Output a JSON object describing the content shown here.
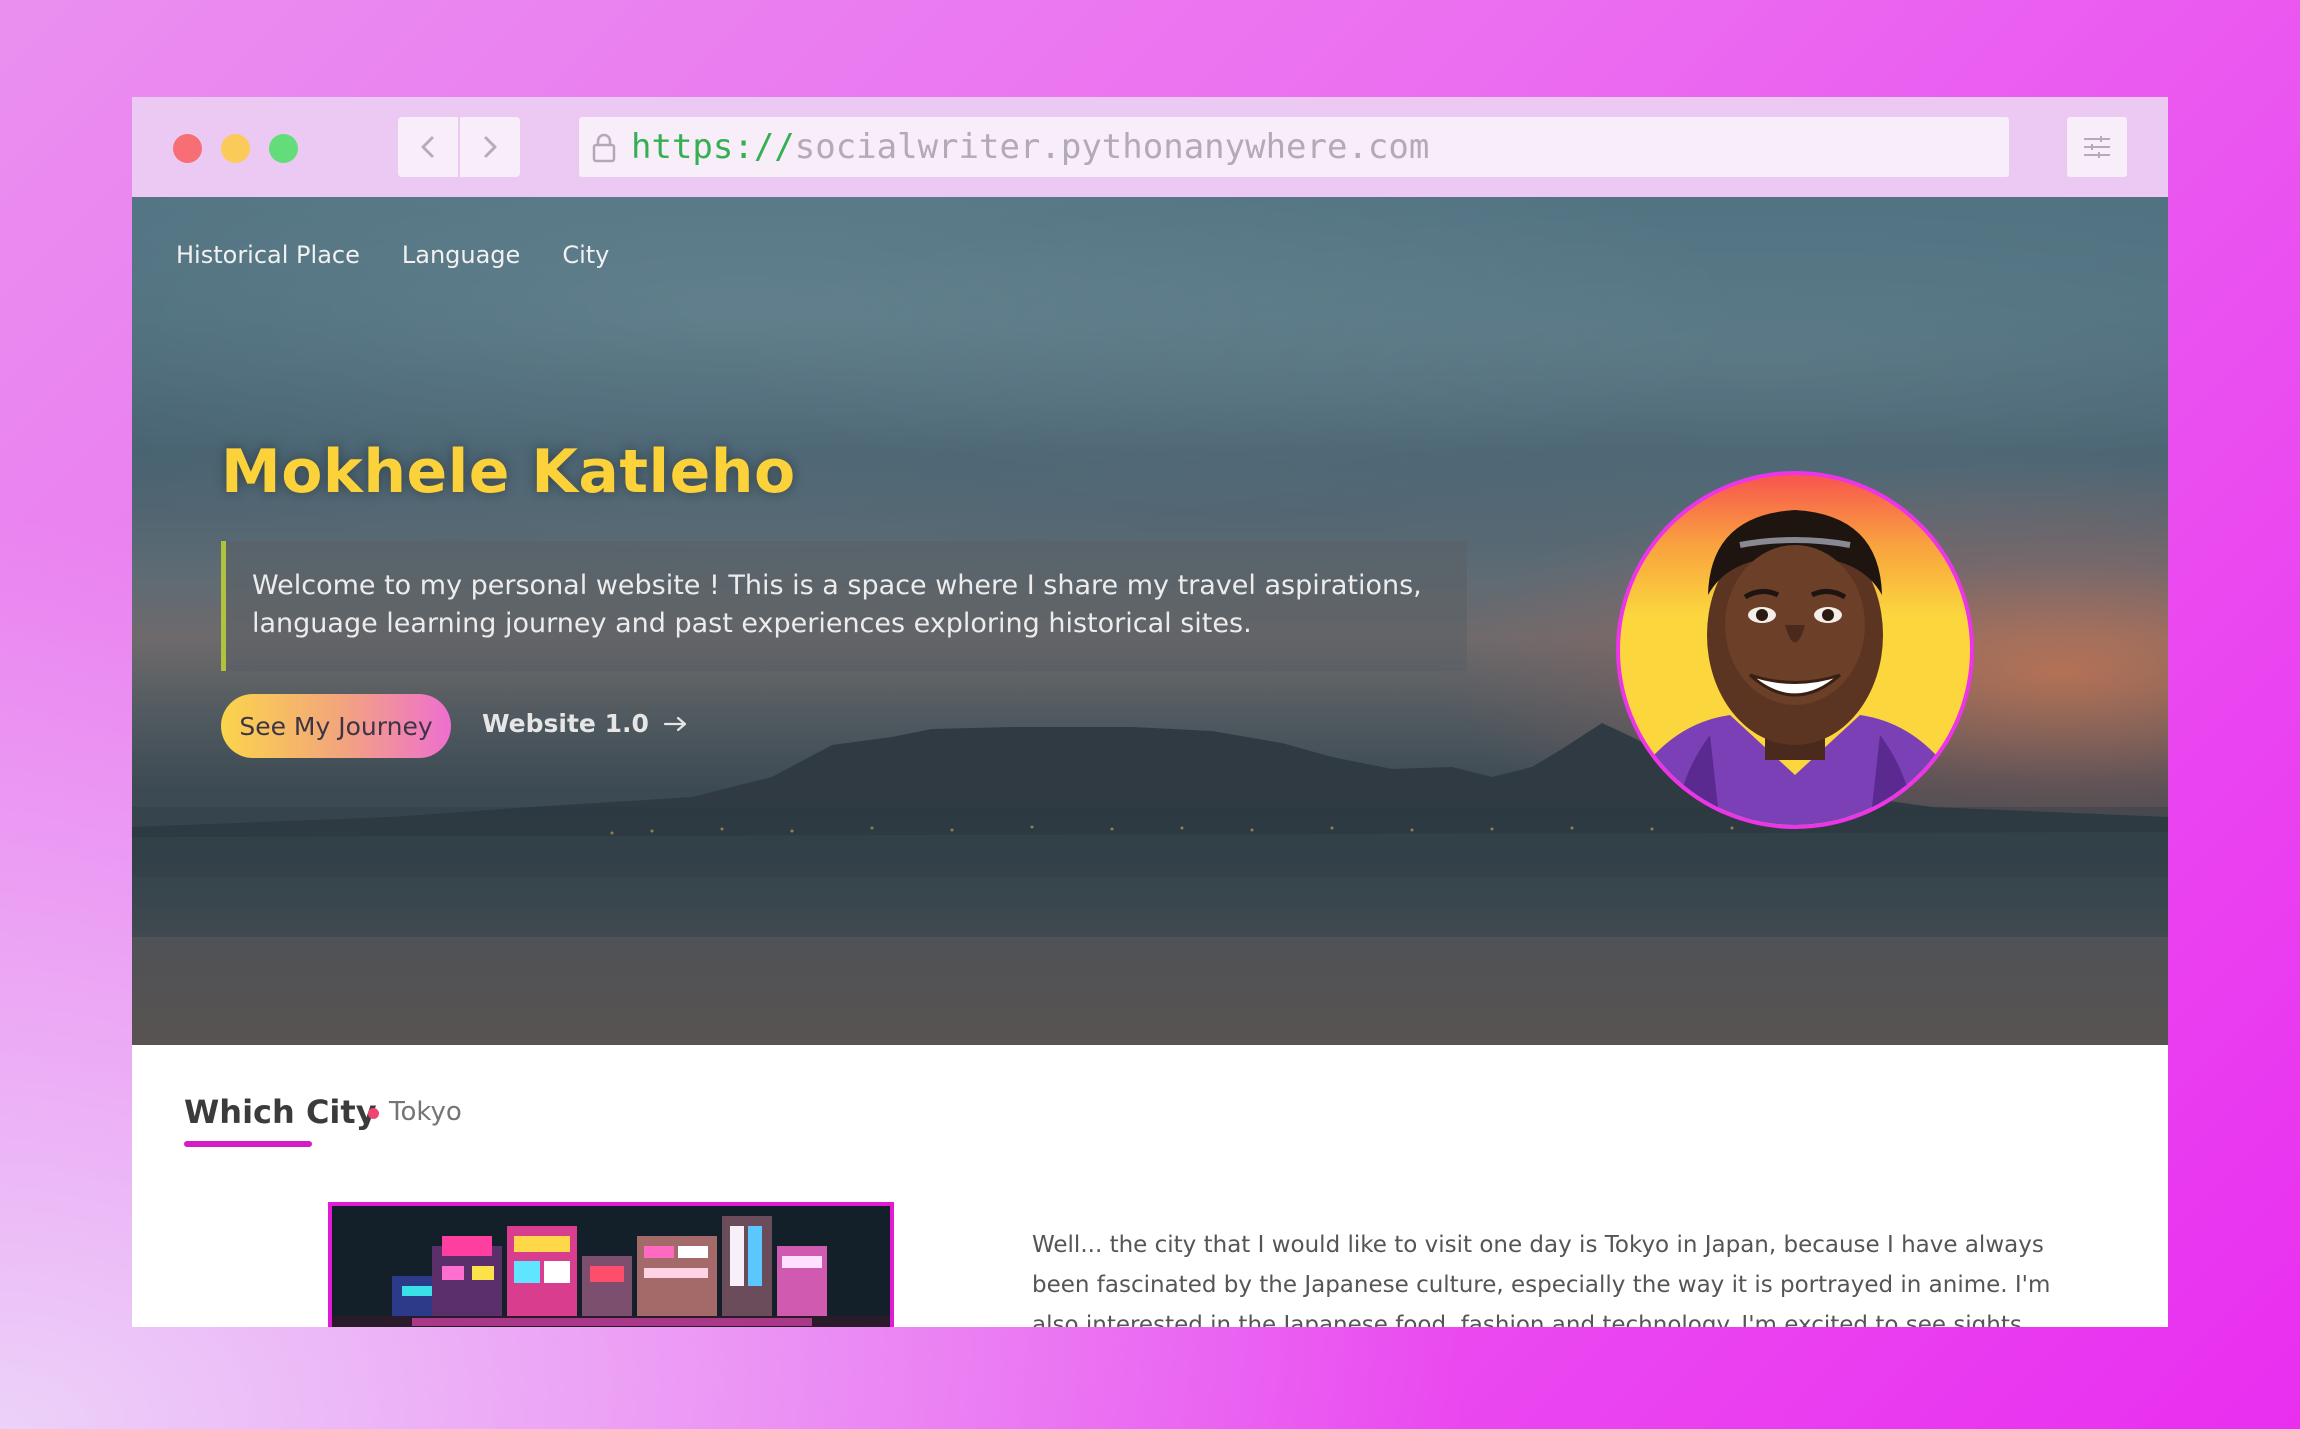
{
  "browser": {
    "url_protocol": "https://",
    "url_host": "socialwriter.pythonanywhere.com"
  },
  "nav": {
    "items": [
      "Historical Place",
      "Language",
      "City"
    ]
  },
  "hero": {
    "name": "Mokhele Katleho",
    "intro": "Welcome to my personal website ! This is a space where I share my travel aspirations, language learning journey and past experiences exploring historical sites.",
    "cta_label": "See My Journey",
    "secondary_link": "Website 1.0"
  },
  "section": {
    "title": "Which City",
    "subtitle": "Tokyo",
    "body": "Well... the city that I would like to visit one day is Tokyo in Japan, because I have always been fascinated by the Japanese culture, especially the way it is portrayed in anime. I'm also interested in the Japanese food, fashion and technology. I'm excited to see sights like"
  },
  "colors": {
    "name": "#fbd23a",
    "accent_magenta": "#d31ec8",
    "quote_border": "#b1c23e"
  }
}
